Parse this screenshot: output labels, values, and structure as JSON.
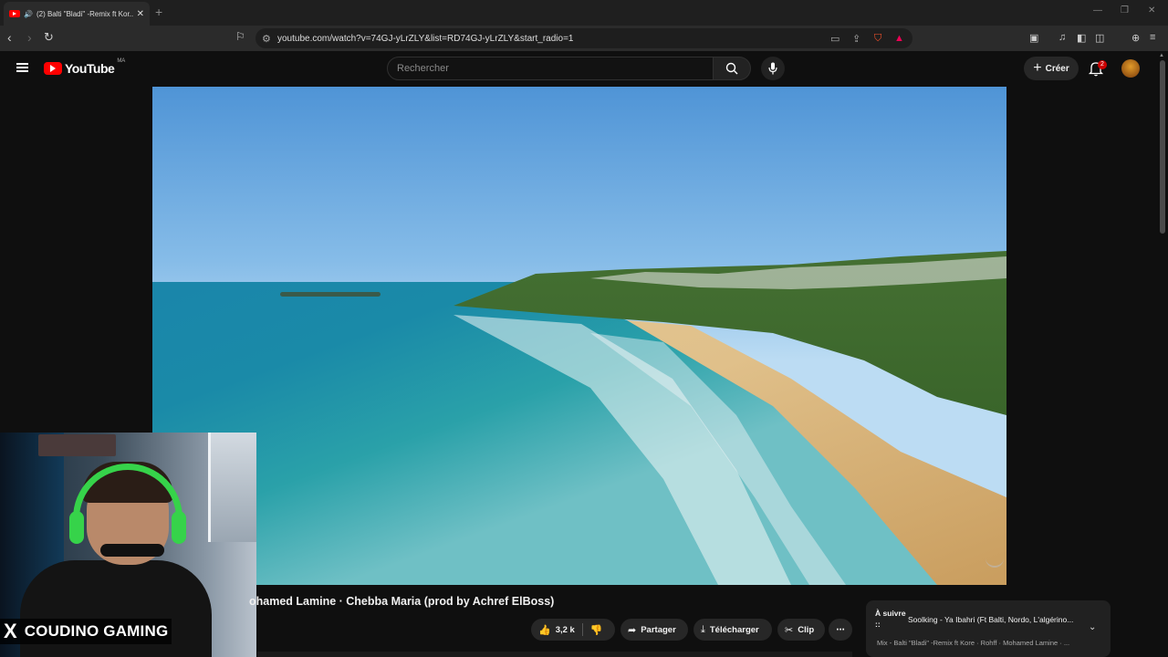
{
  "browser": {
    "tab_title": "(2) Balti \"Bladi\" -Remix ft Kor...",
    "tab_speaker": "🔊",
    "url": "youtube.com/watch?v=74GJ-yLrZLY&list=RD74GJ-yLrZLY&start_radio=1"
  },
  "youtube": {
    "logo_word": "YouTube",
    "country_code": "MA",
    "search_placeholder": "Rechercher",
    "create_label": "Créer",
    "notification_count": "2"
  },
  "video": {
    "title": "ohamed Lamine · Chebba Maria (prod by Achref ElBoss)",
    "likes": "3,2 k",
    "share_label": "Partager",
    "download_label": "Télécharger",
    "clip_label": "Clip"
  },
  "up_next": {
    "label": "À suivre ::",
    "song": "Soolking - Ya Ibahri (Ft Balti, Nordo, L'algérino...",
    "playlist": "Mix - Balti \"Bladi\" -Remix ft Kore · Rohff · Mohamed Lamine · ..."
  },
  "webcam": {
    "brand_letter": "X",
    "streamer_name": "COUDINO GAMING"
  },
  "colors": {
    "yt_red": "#ff0000",
    "bg": "#0f0f0f",
    "headset_green": "#36d34a"
  }
}
